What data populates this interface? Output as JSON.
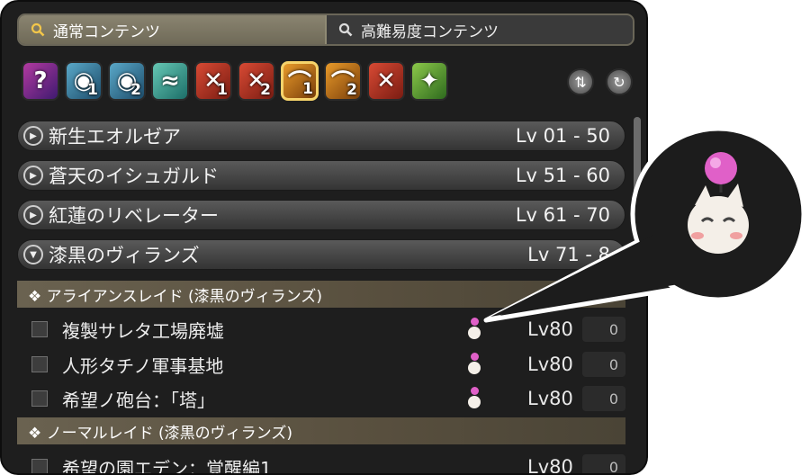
{
  "tabs": [
    {
      "label": "通常コンテンツ",
      "icon": "search-icon",
      "active": true
    },
    {
      "label": "高難易度コンテンツ",
      "icon": "search-icon",
      "active": false
    }
  ],
  "content_icons": [
    {
      "name": "roulette-icon",
      "symbol": "?",
      "number": ""
    },
    {
      "name": "dungeon-icon",
      "symbol": "◉",
      "number": "1"
    },
    {
      "name": "dungeon-icon",
      "symbol": "◉",
      "number": "2"
    },
    {
      "name": "guildhest-icon",
      "symbol": "≈",
      "number": ""
    },
    {
      "name": "trial-icon",
      "symbol": "✕",
      "number": "1"
    },
    {
      "name": "trial-icon",
      "symbol": "✕",
      "number": "2"
    },
    {
      "name": "raid-icon",
      "symbol": "⌒",
      "number": "1"
    },
    {
      "name": "raid-icon",
      "symbol": "⌒",
      "number": "2"
    },
    {
      "name": "pvp-icon",
      "symbol": "✕",
      "number": ""
    },
    {
      "name": "gold-saucer-icon",
      "symbol": "✦",
      "number": ""
    }
  ],
  "categories": [
    {
      "name": "新生エオルゼア",
      "level": "Lv 01 - 50",
      "expanded": false
    },
    {
      "name": "蒼天のイシュガルド",
      "level": "Lv 51 - 60",
      "expanded": false
    },
    {
      "name": "紅蓮のリベレーター",
      "level": "Lv 61 - 70",
      "expanded": false
    },
    {
      "name": "漆黒のヴィランズ",
      "level": "Lv 71 - 8",
      "expanded": true
    }
  ],
  "subsections": [
    {
      "label": "❖ アライアンスレイド (漆黒のヴィランズ)"
    },
    {
      "label": "❖ ノーマルレイド (漆黒のヴィランズ)"
    }
  ],
  "duties": [
    {
      "name": "複製サレタ工場廃墟",
      "level": "Lv80",
      "count": "0"
    },
    {
      "name": "人形タチノ軍事基地",
      "level": "Lv80",
      "count": "0"
    },
    {
      "name": "希望ノ砲台：「塔」",
      "level": "Lv80",
      "count": "0"
    },
    {
      "name": "希望の園エデン：覚醒編1",
      "level": "Lv80",
      "count": "0"
    }
  ],
  "colors": {
    "accent": "#f6d36b",
    "moogle_pompom": "#e060c8"
  }
}
